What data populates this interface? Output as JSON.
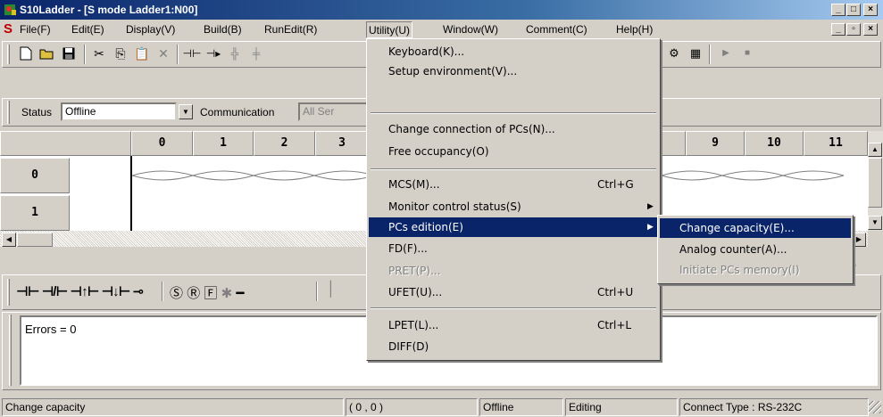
{
  "window": {
    "title": "S10Ladder - [S mode Ladder1:N00]",
    "minimize": "_",
    "maximize": "□",
    "close": "×"
  },
  "menubar": {
    "items": [
      "File(F)",
      "Edit(E)",
      "Display(V)",
      "Build(B)",
      "RunEdit(R)",
      "Utility(U)",
      "Window(W)",
      "Comment(C)",
      "Help(H)"
    ],
    "mdi_min": "_",
    "mdi_restore": "▫",
    "mdi_close": "×"
  },
  "toolbar2": {
    "status_label": "Status",
    "status_value": "Offline",
    "communication_label": "Communication",
    "communication_value": "All Ser"
  },
  "grid": {
    "columns": [
      "0",
      "1",
      "2",
      "3",
      "9",
      "10",
      "11"
    ],
    "rows": [
      "0",
      "1"
    ]
  },
  "output": {
    "text": "Errors = 0"
  },
  "hidden_value": "0",
  "utility_menu": {
    "items": [
      {
        "label": "Keyboard(K)...",
        "shortcut": ""
      },
      {
        "label": "Setup environment(V)...",
        "shortcut": ""
      },
      {
        "label": "Change connection of PCs(N)...",
        "shortcut": ""
      },
      {
        "label": "Free occupancy(O)",
        "shortcut": ""
      },
      {
        "label": "MCS(M)...",
        "shortcut": "Ctrl+G"
      },
      {
        "label": "Monitor control status(S)",
        "shortcut": ""
      },
      {
        "label": "PCs edition(E)",
        "shortcut": ""
      },
      {
        "label": "FD(F)...",
        "shortcut": ""
      },
      {
        "label": "PRET(P)...",
        "shortcut": ""
      },
      {
        "label": "UFET(U)...",
        "shortcut": "Ctrl+U"
      },
      {
        "label": "LPET(L)...",
        "shortcut": "Ctrl+L"
      },
      {
        "label": "DIFF(D)",
        "shortcut": ""
      }
    ]
  },
  "pcs_submenu": {
    "items": [
      "Change capacity(E)...",
      "Analog counter(A)...",
      "Initiate PCs memory(I)"
    ]
  },
  "statusbar": {
    "message": "Change capacity",
    "position": "( 0 , 0 )",
    "connection": "Offline",
    "mode": "Editing",
    "connect_type": "Connect Type : RS-232C"
  },
  "colors": {
    "title_active": "#0a246a",
    "highlight": "#0a246a",
    "face": "#d4d0c8"
  }
}
